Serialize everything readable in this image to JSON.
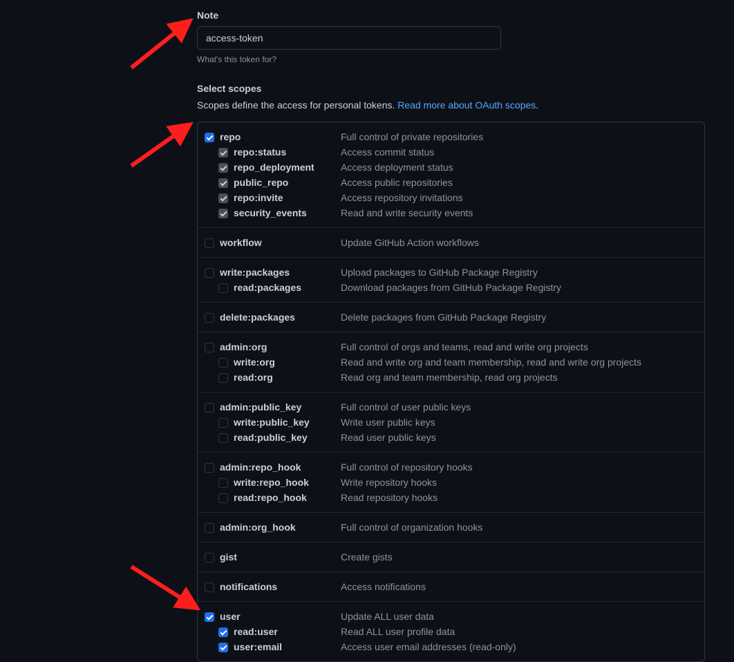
{
  "note": {
    "label": "Note",
    "value": "access-token",
    "help": "What's this token for?"
  },
  "scopes_section": {
    "heading": "Select scopes",
    "description": "Scopes define the access for personal tokens. ",
    "link_text": "Read more about OAuth scopes",
    "period": "."
  },
  "scopes": [
    {
      "name": "repo",
      "desc": "Full control of private repositories",
      "checked": true,
      "children": [
        {
          "name": "repo:status",
          "desc": "Access commit status",
          "checked": true,
          "subchecked": true
        },
        {
          "name": "repo_deployment",
          "desc": "Access deployment status",
          "checked": true,
          "subchecked": true
        },
        {
          "name": "public_repo",
          "desc": "Access public repositories",
          "checked": true,
          "subchecked": true
        },
        {
          "name": "repo:invite",
          "desc": "Access repository invitations",
          "checked": true,
          "subchecked": true
        },
        {
          "name": "security_events",
          "desc": "Read and write security events",
          "checked": true,
          "subchecked": true
        }
      ]
    },
    {
      "name": "workflow",
      "desc": "Update GitHub Action workflows",
      "checked": false,
      "children": []
    },
    {
      "name": "write:packages",
      "desc": "Upload packages to GitHub Package Registry",
      "checked": false,
      "children": [
        {
          "name": "read:packages",
          "desc": "Download packages from GitHub Package Registry",
          "checked": false
        }
      ]
    },
    {
      "name": "delete:packages",
      "desc": "Delete packages from GitHub Package Registry",
      "checked": false,
      "children": []
    },
    {
      "name": "admin:org",
      "desc": "Full control of orgs and teams, read and write org projects",
      "checked": false,
      "children": [
        {
          "name": "write:org",
          "desc": "Read and write org and team membership, read and write org projects",
          "checked": false
        },
        {
          "name": "read:org",
          "desc": "Read org and team membership, read org projects",
          "checked": false
        }
      ]
    },
    {
      "name": "admin:public_key",
      "desc": "Full control of user public keys",
      "checked": false,
      "children": [
        {
          "name": "write:public_key",
          "desc": "Write user public keys",
          "checked": false
        },
        {
          "name": "read:public_key",
          "desc": "Read user public keys",
          "checked": false
        }
      ]
    },
    {
      "name": "admin:repo_hook",
      "desc": "Full control of repository hooks",
      "checked": false,
      "children": [
        {
          "name": "write:repo_hook",
          "desc": "Write repository hooks",
          "checked": false
        },
        {
          "name": "read:repo_hook",
          "desc": "Read repository hooks",
          "checked": false
        }
      ]
    },
    {
      "name": "admin:org_hook",
      "desc": "Full control of organization hooks",
      "checked": false,
      "children": []
    },
    {
      "name": "gist",
      "desc": "Create gists",
      "checked": false,
      "children": []
    },
    {
      "name": "notifications",
      "desc": "Access notifications",
      "checked": false,
      "children": []
    },
    {
      "name": "user",
      "desc": "Update ALL user data",
      "checked": true,
      "children": [
        {
          "name": "read:user",
          "desc": "Read ALL user profile data",
          "checked": true
        },
        {
          "name": "user:email",
          "desc": "Access user email addresses (read-only)",
          "checked": true
        }
      ]
    }
  ]
}
